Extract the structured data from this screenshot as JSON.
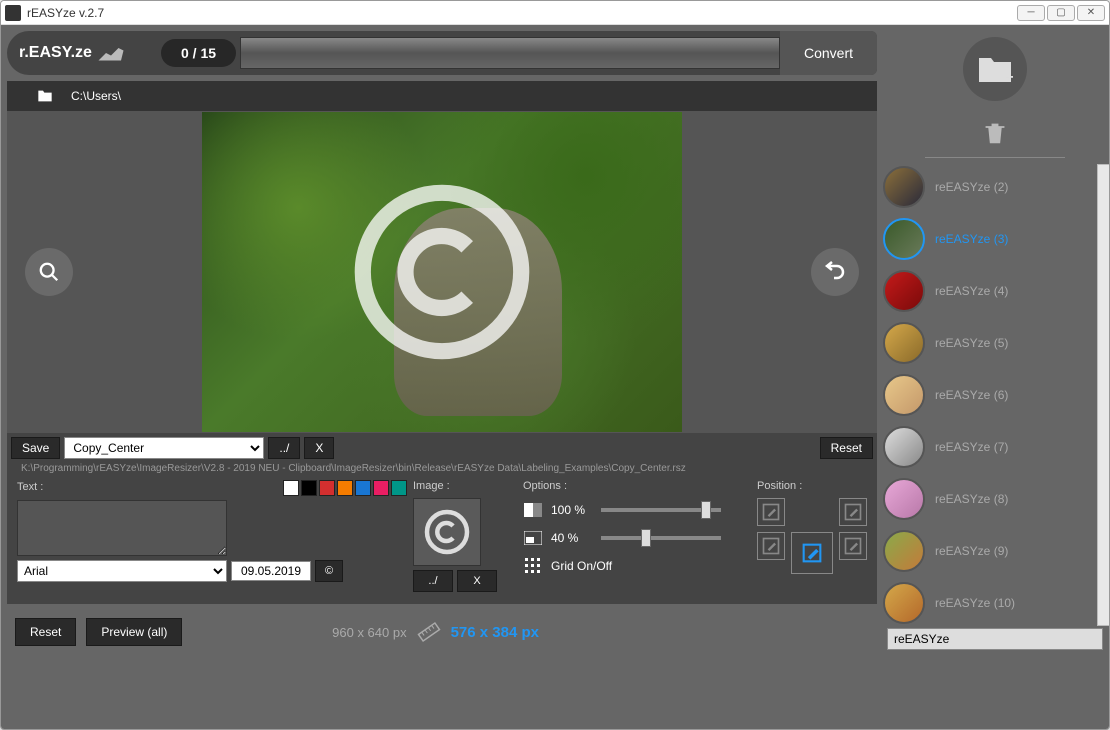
{
  "title": "rEASYze v.2.7",
  "logo_text": "r.EASY.ze",
  "counter": "0 / 15",
  "convert_label": "Convert",
  "browse_path": "C:\\Users\\",
  "watermark": {
    "save_label": "Save",
    "preset": "Copy_Center",
    "browse_label": "../",
    "x_label": "X",
    "reset_label": "Reset",
    "path": "K:\\Programming\\rEASYze\\ImageResizer\\V2.8 - 2019   NEU - Clipboard\\ImageResizer\\bin\\Release\\rEASYze Data\\Labeling_Examples\\Copy_Center.rsz",
    "text_label": "Text :",
    "image_label": "Image :",
    "options_label": "Options :",
    "position_label": "Position :",
    "font": "Arial",
    "date": "09.05.2019",
    "copyright_symbol": "©",
    "opacity1": "100 %",
    "opacity2": "40 %",
    "grid_label": "Grid On/Off",
    "colors": [
      "#ffffff",
      "#000000",
      "#d32f2f",
      "#f57c00",
      "#1976d2",
      "#e91e63",
      "#009688"
    ]
  },
  "footer": {
    "reset": "Reset",
    "preview": "Preview (all)",
    "orig_dim": "960 x 640 px",
    "new_dim": "576 x 384 px"
  },
  "thumbs": [
    {
      "label": "reEASYze (2)",
      "bg": "linear-gradient(135deg,#8b6f3a,#2a2a3a)"
    },
    {
      "label": "reEASYze (3)",
      "bg": "linear-gradient(135deg,#3a5a2a,#6a7a5a)",
      "selected": true
    },
    {
      "label": "reEASYze (4)",
      "bg": "linear-gradient(135deg,#c41a1a,#7a0a0a)"
    },
    {
      "label": "reEASYze (5)",
      "bg": "linear-gradient(135deg,#d4a84a,#8a6a2a)"
    },
    {
      "label": "reEASYze (6)",
      "bg": "linear-gradient(135deg,#e8c88a,#c4986a)"
    },
    {
      "label": "reEASYze (7)",
      "bg": "linear-gradient(135deg,#ddd,#888)"
    },
    {
      "label": "reEASYze (8)",
      "bg": "linear-gradient(135deg,#e8a8d8,#b878a8)"
    },
    {
      "label": "reEASYze (9)",
      "bg": "linear-gradient(135deg,#8aaa4a,#c47a3a)"
    },
    {
      "label": "reEASYze (10)",
      "bg": "linear-gradient(135deg,#d4a84a,#b4682a)"
    }
  ],
  "name_input": "reEASYze"
}
